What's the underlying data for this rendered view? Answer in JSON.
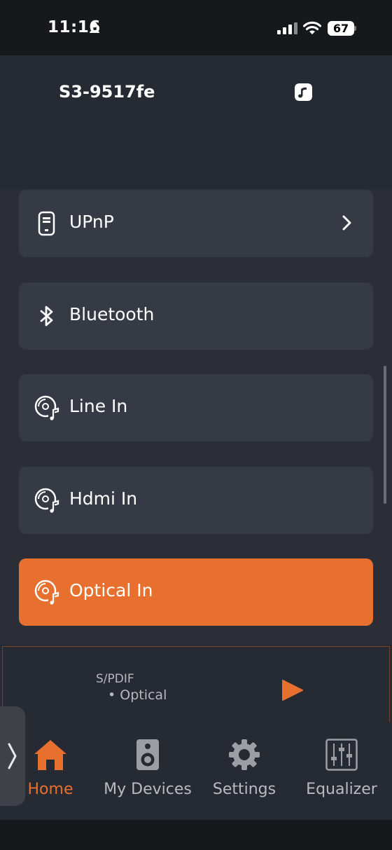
{
  "status_bar": {
    "time": "11:16",
    "battery": "67"
  },
  "header": {
    "device_name": "S3-9517fe",
    "music_icon": "music-note-icon"
  },
  "sources": [
    {
      "label": "UPnP",
      "icon": "phone-icon",
      "has_chevron": true,
      "active": false
    },
    {
      "label": "Bluetooth",
      "icon": "bluetooth-icon",
      "has_chevron": false,
      "active": false
    },
    {
      "label": "Line In",
      "icon": "disc-music-icon",
      "has_chevron": false,
      "active": false
    },
    {
      "label": "Hdmi In",
      "icon": "disc-music-icon",
      "has_chevron": false,
      "active": false
    },
    {
      "label": "Optical In",
      "icon": "disc-music-icon",
      "has_chevron": false,
      "active": true
    }
  ],
  "now_playing": {
    "title": "S/PDIF",
    "subtitle": "• Optical"
  },
  "tabs": [
    {
      "label": "Home",
      "icon": "home-icon",
      "active": true
    },
    {
      "label": "My Devices",
      "icon": "speaker-icon",
      "active": false
    },
    {
      "label": "Settings",
      "icon": "gear-icon",
      "active": false
    },
    {
      "label": "Equalizer",
      "icon": "equalizer-icon",
      "active": false
    }
  ],
  "colors": {
    "accent": "#e8702f",
    "background": "#262a33",
    "item_background": "#363a45"
  }
}
